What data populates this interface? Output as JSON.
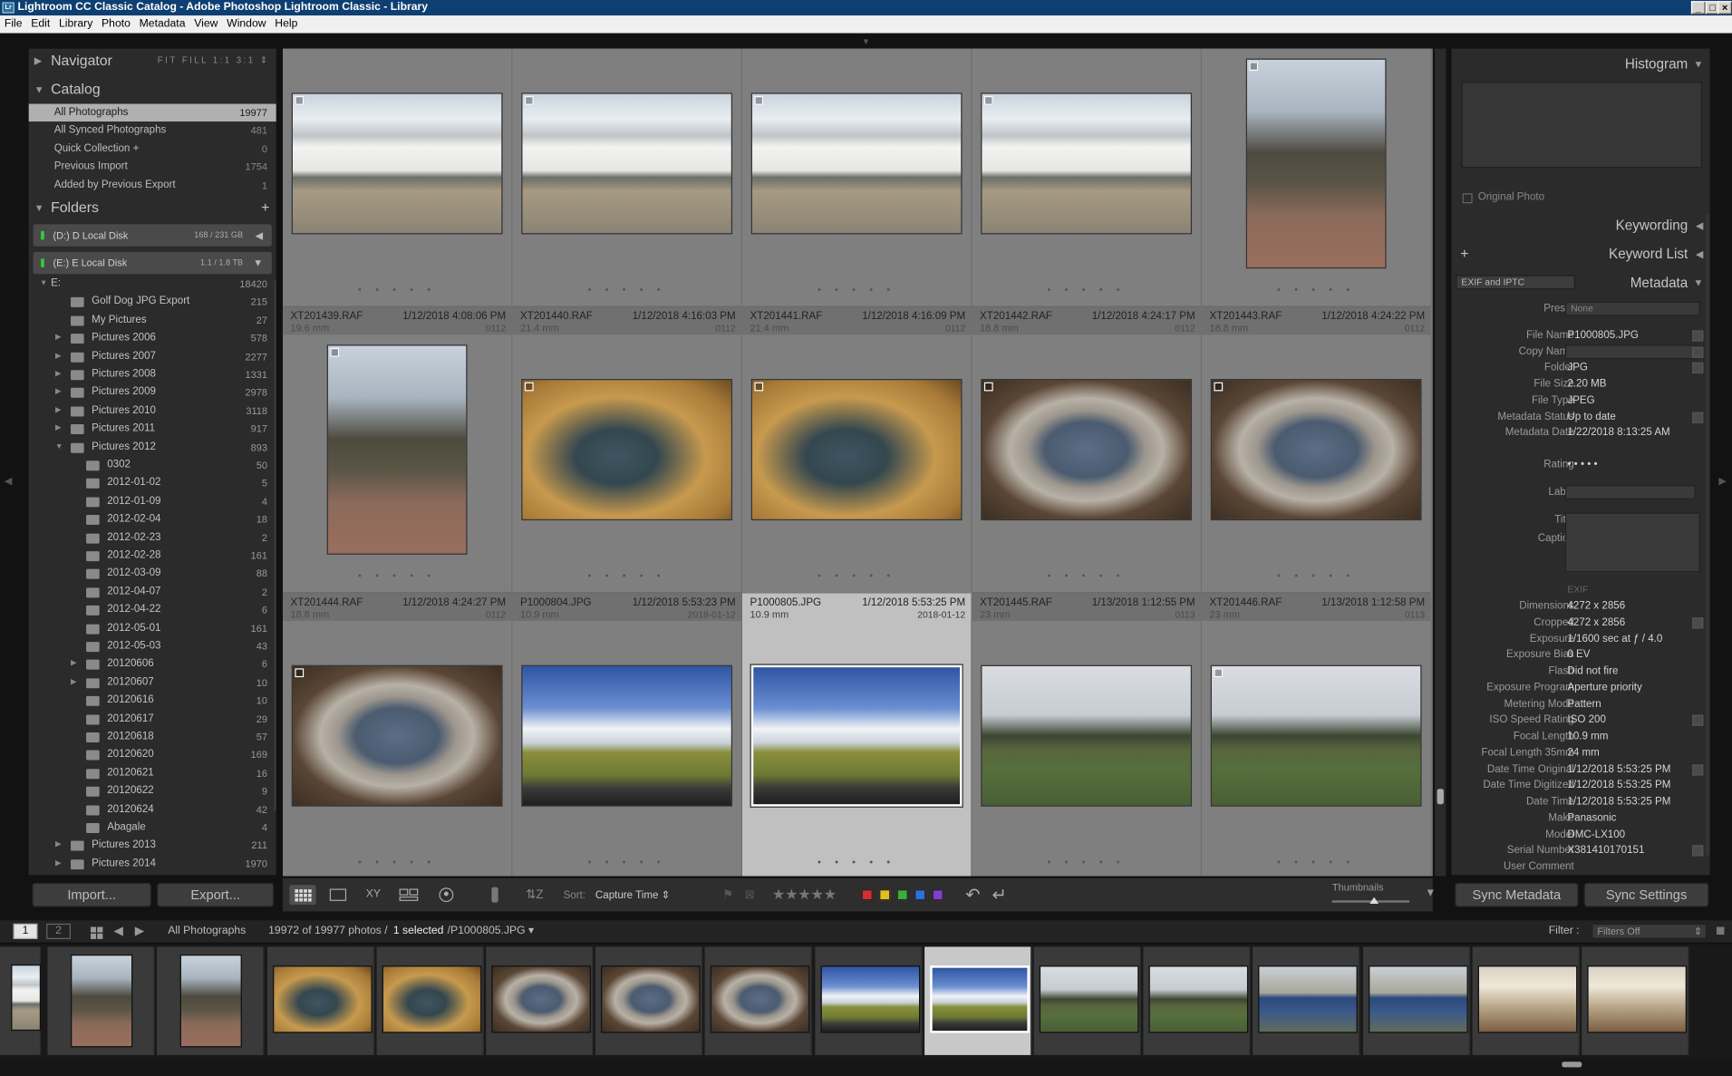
{
  "app": {
    "title": "Lightroom CC Classic Catalog - Adobe Photoshop Lightroom Classic - Library",
    "icon_label": "Lr"
  },
  "menu": [
    "File",
    "Edit",
    "Library",
    "Photo",
    "Metadata",
    "View",
    "Window",
    "Help"
  ],
  "navigator": {
    "title": "Navigator",
    "modes": "FIT  FILL  1:1  3:1 ⇕"
  },
  "catalog": {
    "title": "Catalog",
    "items": [
      {
        "label": "All Photographs",
        "count": "19977",
        "selected": true
      },
      {
        "label": "All Synced Photographs",
        "count": "481"
      },
      {
        "label": "Quick Collection  +",
        "count": "0"
      },
      {
        "label": "Previous Import",
        "count": "1754"
      },
      {
        "label": "Added by Previous Export",
        "count": "1"
      }
    ]
  },
  "folders": {
    "title": "Folders",
    "add": "+",
    "volumes": [
      {
        "label": "(D:) D Local Disk",
        "size": "168 / 231 GB",
        "arrow": "◀"
      },
      {
        "label": "(E:) E Local Disk",
        "size": "1.1 / 1.8 TB",
        "arrow": "▼"
      }
    ],
    "items": [
      {
        "name": "E:",
        "count": "18420",
        "level": 0,
        "tri": "▼",
        "icon": false
      },
      {
        "name": "Golf Dog JPG Export",
        "count": "215",
        "level": 1,
        "tri": "",
        "icon": true
      },
      {
        "name": "My Pictures",
        "count": "27",
        "level": 1,
        "tri": "",
        "icon": true
      },
      {
        "name": "Pictures 2006",
        "count": "578",
        "level": 1,
        "tri": "▶",
        "icon": true
      },
      {
        "name": "Pictures 2007",
        "count": "2277",
        "level": 1,
        "tri": "▶",
        "icon": true
      },
      {
        "name": "Pictures 2008",
        "count": "1331",
        "level": 1,
        "tri": "▶",
        "icon": true
      },
      {
        "name": "Pictures 2009",
        "count": "2978",
        "level": 1,
        "tri": "▶",
        "icon": true
      },
      {
        "name": "Pictures 2010",
        "count": "3118",
        "level": 1,
        "tri": "▶",
        "icon": true
      },
      {
        "name": "Pictures 2011",
        "count": "917",
        "level": 1,
        "tri": "▶",
        "icon": true
      },
      {
        "name": "Pictures 2012",
        "count": "893",
        "level": 1,
        "tri": "▼",
        "icon": true
      },
      {
        "name": "0302",
        "count": "50",
        "level": 2,
        "tri": "",
        "icon": true
      },
      {
        "name": "2012-01-02",
        "count": "5",
        "level": 2,
        "tri": "",
        "icon": true
      },
      {
        "name": "2012-01-09",
        "count": "4",
        "level": 2,
        "tri": "",
        "icon": true
      },
      {
        "name": "2012-02-04",
        "count": "18",
        "level": 2,
        "tri": "",
        "icon": true
      },
      {
        "name": "2012-02-23",
        "count": "2",
        "level": 2,
        "tri": "",
        "icon": true
      },
      {
        "name": "2012-02-28",
        "count": "161",
        "level": 2,
        "tri": "",
        "icon": true
      },
      {
        "name": "2012-03-09",
        "count": "88",
        "level": 2,
        "tri": "",
        "icon": true
      },
      {
        "name": "2012-04-07",
        "count": "2",
        "level": 2,
        "tri": "",
        "icon": true
      },
      {
        "name": "2012-04-22",
        "count": "6",
        "level": 2,
        "tri": "",
        "icon": true
      },
      {
        "name": "2012-05-01",
        "count": "161",
        "level": 2,
        "tri": "",
        "icon": true
      },
      {
        "name": "2012-05-03",
        "count": "43",
        "level": 2,
        "tri": "",
        "icon": true
      },
      {
        "name": "20120606",
        "count": "6",
        "level": 2,
        "tri": "▶",
        "icon": true
      },
      {
        "name": "20120607",
        "count": "10",
        "level": 2,
        "tri": "▶",
        "icon": true
      },
      {
        "name": "20120616",
        "count": "10",
        "level": 2,
        "tri": "",
        "icon": true
      },
      {
        "name": "20120617",
        "count": "29",
        "level": 2,
        "tri": "",
        "icon": true
      },
      {
        "name": "20120618",
        "count": "57",
        "level": 2,
        "tri": "",
        "icon": true
      },
      {
        "name": "20120620",
        "count": "169",
        "level": 2,
        "tri": "",
        "icon": true
      },
      {
        "name": "20120621",
        "count": "16",
        "level": 2,
        "tri": "",
        "icon": true
      },
      {
        "name": "20120622",
        "count": "9",
        "level": 2,
        "tri": "",
        "icon": true
      },
      {
        "name": "20120624",
        "count": "42",
        "level": 2,
        "tri": "",
        "icon": true
      },
      {
        "name": "Abagale",
        "count": "4",
        "level": 2,
        "tri": "",
        "icon": true
      },
      {
        "name": "Pictures 2013",
        "count": "211",
        "level": 1,
        "tri": "▶",
        "icon": true
      },
      {
        "name": "Pictures 2014",
        "count": "1970",
        "level": 1,
        "tri": "▶",
        "icon": true
      }
    ]
  },
  "grid": {
    "rows": [
      [
        {
          "kind": "house",
          "orient": "l",
          "badge": true
        },
        {
          "kind": "house",
          "orient": "l",
          "badge": true
        },
        {
          "kind": "house",
          "orient": "l",
          "badge": true
        },
        {
          "kind": "house",
          "orient": "l",
          "badge": true
        },
        {
          "kind": "tree",
          "orient": "p",
          "badge": true
        }
      ],
      [
        {
          "kind": "tree",
          "orient": "p",
          "badge": true
        },
        {
          "kind": "photo",
          "orient": "l",
          "badge": true
        },
        {
          "kind": "photo",
          "orient": "l",
          "badge": true
        },
        {
          "kind": "plaque",
          "orient": "l",
          "badge": true
        },
        {
          "kind": "plaque",
          "orient": "l",
          "badge": true
        }
      ],
      [
        {
          "kind": "plaque",
          "orient": "l",
          "badge": true
        },
        {
          "kind": "field",
          "orient": "l",
          "badge": false
        },
        {
          "kind": "field",
          "orient": "l",
          "badge": false,
          "selected": true
        },
        {
          "kind": "farm",
          "orient": "l",
          "badge": false
        },
        {
          "kind": "farm",
          "orient": "l",
          "badge": true
        }
      ]
    ],
    "headers": [
      [
        {
          "name": "XT201439.RAF",
          "date": "1/12/2018 4:08:06 PM",
          "focal": "19.6 mm",
          "cid": "0112"
        },
        {
          "name": "XT201440.RAF",
          "date": "1/12/2018 4:16:03 PM",
          "focal": "21.4 mm",
          "cid": "0112"
        },
        {
          "name": "XT201441.RAF",
          "date": "1/12/2018 4:16:09 PM",
          "focal": "21.4 mm",
          "cid": "0112"
        },
        {
          "name": "XT201442.RAF",
          "date": "1/12/2018 4:24:17 PM",
          "focal": "18.8 mm",
          "cid": "0112"
        },
        {
          "name": "XT201443.RAF",
          "date": "1/12/2018 4:24:22 PM",
          "focal": "18.8 mm",
          "cid": "0112"
        }
      ],
      [
        {
          "name": "XT201444.RAF",
          "date": "1/12/2018 4:24:27 PM",
          "focal": "18.8 mm",
          "cid": "0112"
        },
        {
          "name": "P1000804.JPG",
          "date": "1/12/2018 5:53:23 PM",
          "focal": "10.9 mm",
          "cid": "2018-01-12"
        },
        {
          "name": "P1000805.JPG",
          "date": "1/12/2018 5:53:25 PM",
          "focal": "10.9 mm",
          "cid": "2018-01-12",
          "selected": true
        },
        {
          "name": "XT201445.RAF",
          "date": "1/13/2018 1:12:55 PM",
          "focal": "23 mm",
          "cid": "0113"
        },
        {
          "name": "XT201446.RAF",
          "date": "1/13/2018 1:12:58 PM",
          "focal": "23 mm",
          "cid": "0113"
        }
      ]
    ],
    "dots": "• • • • •"
  },
  "right": {
    "histogram": "Histogram",
    "original_photo": "Original Photo",
    "keywording": "Keywording",
    "keyword_list": "Keyword List",
    "keyword_add": "+",
    "metadata": "Metadata",
    "metadata_set": "EXIF and IPTC",
    "preset_label": "Preset",
    "preset_value": "None",
    "fields": [
      {
        "k": "File Name",
        "v": "P1000805.JPG"
      },
      {
        "k": "Copy Name",
        "v": ""
      },
      {
        "k": "Folder",
        "v": "JPG"
      },
      {
        "k": "File Size",
        "v": "2.20 MB"
      },
      {
        "k": "File Type",
        "v": "JPEG"
      },
      {
        "k": "Metadata Status",
        "v": "Up to date"
      },
      {
        "k": "Metadata Date",
        "v": "1/22/2018 8:13:25 AM"
      }
    ],
    "rating_label": "Rating",
    "rating_value": "• • • • •",
    "label_label": "Label",
    "title_label": "Title",
    "caption_label": "Caption",
    "exif_label": "EXIF",
    "exif": [
      {
        "k": "Dimensions",
        "v": "4272 x 2856"
      },
      {
        "k": "Cropped",
        "v": "4272 x 2856"
      },
      {
        "k": "Exposure",
        "v": "1/1600 sec at ƒ / 4.0"
      },
      {
        "k": "Exposure Bias",
        "v": "0 EV"
      },
      {
        "k": "Flash",
        "v": "Did not fire"
      },
      {
        "k": "Exposure Program",
        "v": "Aperture priority"
      },
      {
        "k": "Metering Mode",
        "v": "Pattern"
      },
      {
        "k": "ISO Speed Rating",
        "v": "ISO 200"
      },
      {
        "k": "Focal Length",
        "v": "10.9 mm"
      },
      {
        "k": "Focal Length 35mm",
        "v": "24 mm"
      },
      {
        "k": "Date Time Original",
        "v": "1/12/2018 5:53:25 PM"
      },
      {
        "k": "Date Time Digitized",
        "v": "1/12/2018 5:53:25 PM"
      },
      {
        "k": "Date Time",
        "v": "1/12/2018 5:53:25 PM"
      },
      {
        "k": "Make",
        "v": "Panasonic"
      },
      {
        "k": "Model",
        "v": "DMC-LX100"
      },
      {
        "k": "Serial Number",
        "v": "X381410170151"
      },
      {
        "k": "User Comment",
        "v": ""
      }
    ],
    "sync_metadata": "Sync Metadata",
    "sync_settings": "Sync Settings"
  },
  "toolbar": {
    "sort_label": "Sort:",
    "sort_value": "Capture Time",
    "stars": "★★★★★",
    "thumbs_label": "Thumbnails",
    "label_colors": [
      "#d32f2f",
      "#e0c020",
      "#3cae3c",
      "#2f6fd6",
      "#7e3fc9"
    ]
  },
  "bottom": {
    "import": "Import...",
    "export": "Export...",
    "page1": "1",
    "page2": "2",
    "source": "All Photographs",
    "count_text": "19972 of 19977 photos /",
    "selected_text": "1 selected",
    "file_text": "/P1000805.JPG",
    "filter_label": "Filter :",
    "filter_value": "Filters Off"
  },
  "filmstrip": [
    {
      "kind": "house",
      "orient": "partial"
    },
    {
      "kind": "tree",
      "orient": "p"
    },
    {
      "kind": "tree",
      "orient": "p"
    },
    {
      "kind": "photo",
      "orient": "l"
    },
    {
      "kind": "photo",
      "orient": "l"
    },
    {
      "kind": "plaque",
      "orient": "l"
    },
    {
      "kind": "plaque",
      "orient": "l"
    },
    {
      "kind": "plaque",
      "orient": "l"
    },
    {
      "kind": "field",
      "orient": "l"
    },
    {
      "kind": "field",
      "orient": "l",
      "selected": true
    },
    {
      "kind": "farm",
      "orient": "l"
    },
    {
      "kind": "farm",
      "orient": "l"
    },
    {
      "kind": "sign",
      "orient": "l"
    },
    {
      "kind": "sign",
      "orient": "l"
    },
    {
      "kind": "board",
      "orient": "l"
    },
    {
      "kind": "board",
      "orient": "l"
    }
  ]
}
